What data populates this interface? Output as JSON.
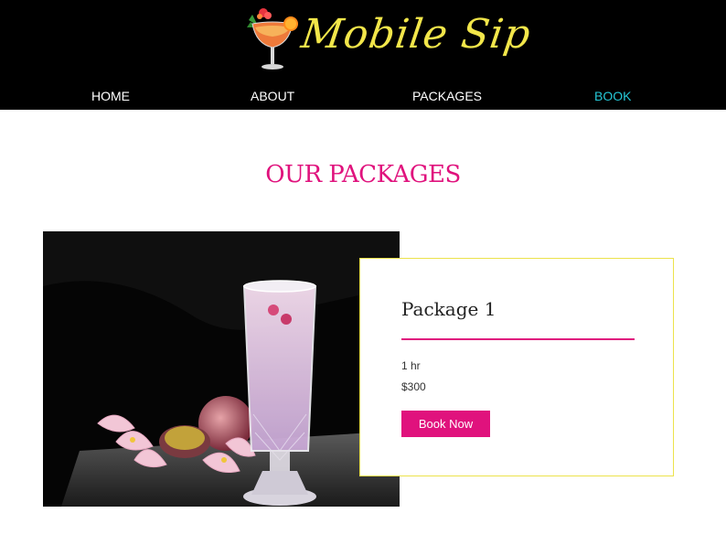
{
  "brand": {
    "name": "Mobile Sip",
    "logo_icon": "cocktail-glass-icon"
  },
  "nav": {
    "items": [
      {
        "label": "HOME"
      },
      {
        "label": "ABOUT"
      },
      {
        "label": "PACKAGES"
      },
      {
        "label": "BOOK",
        "active": true
      }
    ]
  },
  "page": {
    "title": "OUR PACKAGES"
  },
  "package": {
    "name": "Package 1",
    "duration": "1 hr",
    "price": "$300",
    "button_label": "Book Now",
    "image": "pink-sparkling-cocktail-with-passion-fruit-and-flowers"
  },
  "colors": {
    "header_bg": "#000000",
    "accent_pink": "#e0127d",
    "logo_yellow": "#f2e64a",
    "nav_active": "#25c7d6",
    "card_border": "#ece24b"
  }
}
